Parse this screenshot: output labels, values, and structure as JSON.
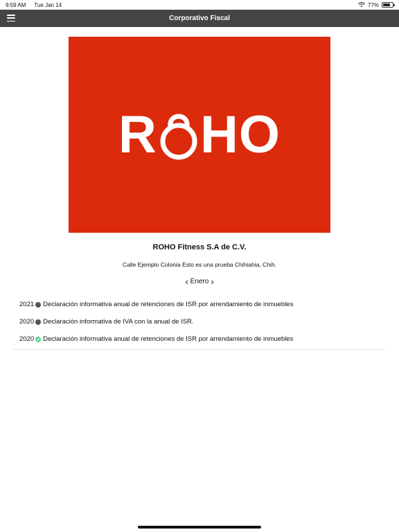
{
  "status_bar": {
    "time": "9:59 AM",
    "date": "Tue Jan 14",
    "battery": "77%"
  },
  "nav": {
    "title": "Corporativo Fiscal"
  },
  "logo": {
    "letters_left": "R",
    "letters_right": "HO",
    "background": "#dc2a0c"
  },
  "company": {
    "name": "ROHO Fitness S.A de C.V.",
    "address": "Calle Ejemplo Colonia Esto es una prueba Chihiahia, Chih."
  },
  "month_picker": {
    "month": "Enero",
    "prev": "‹",
    "next": "›"
  },
  "declarations": [
    {
      "year": "2021",
      "status": "pending",
      "text": "Declaración informativa anual de retenciones de ISR por arrendamiento de inmuebles"
    },
    {
      "year": "2020",
      "status": "pending",
      "text": "Declaración informativa de IVA con la anual de ISR."
    },
    {
      "year": "2020",
      "status": "done",
      "text": "Declaración informativa anual de retenciones de ISR por arrendamiento de inmuebles"
    }
  ],
  "colors": {
    "nav_bar": "#454545",
    "status_pending": "#555555",
    "status_done": "#4cd98a"
  }
}
